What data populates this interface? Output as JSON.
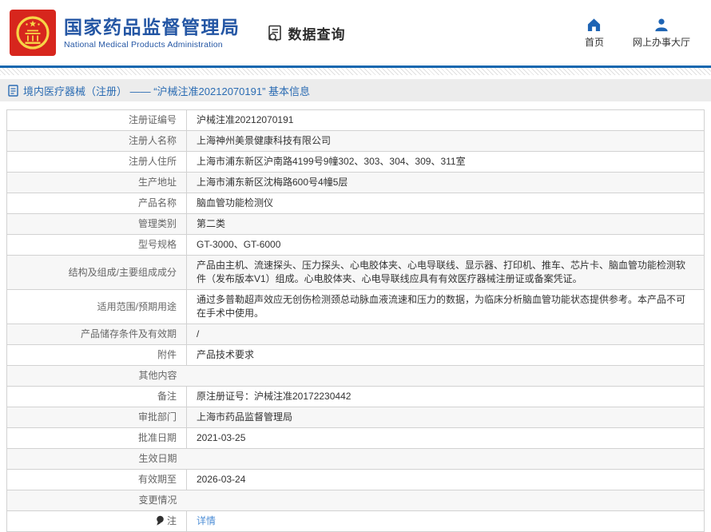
{
  "header": {
    "brand_cn": "国家药品监督管理局",
    "brand_en": "National Medical Products Administration",
    "section_title": "数据查询",
    "nav": [
      {
        "label": "首页",
        "icon": "home-icon"
      },
      {
        "label": "网上办事大厅",
        "icon": "user-icon"
      }
    ]
  },
  "breadcrumb": {
    "text": "境内医疗器械（注册） —— “沪械注准20212070191” 基本信息"
  },
  "table": {
    "rows": [
      {
        "label": "注册证编号",
        "value": "沪械注准20212070191"
      },
      {
        "label": "注册人名称",
        "value": "上海神州美景健康科技有限公司"
      },
      {
        "label": "注册人住所",
        "value": "上海市浦东新区沪南路4199号9幢302、303、304、309、311室"
      },
      {
        "label": "生产地址",
        "value": "上海市浦东新区沈梅路600号4幢5层"
      },
      {
        "label": "产品名称",
        "value": "脑血管功能检测仪"
      },
      {
        "label": "管理类别",
        "value": "第二类"
      },
      {
        "label": "型号规格",
        "value": "GT-3000、GT-6000"
      },
      {
        "label": "结构及组成/主要组成成分",
        "value": "产品由主机、流速探头、压力探头、心电胶体夹、心电导联线、显示器、打印机、推车、芯片卡、脑血管功能检测软件（发布版本V1）组成。心电胶体夹、心电导联线应具有有效医疗器械注册证或备案凭证。"
      },
      {
        "label": "适用范围/预期用途",
        "value": "通过多普勒超声效应无创伤检测颈总动脉血液流速和压力的数据，为临床分析脑血管功能状态提供参考。本产品不可在手术中使用。"
      },
      {
        "label": "产品储存条件及有效期",
        "value": "/"
      },
      {
        "label": "附件",
        "value": "产品技术要求"
      },
      {
        "label": "其他内容",
        "value": ""
      },
      {
        "label": "备注",
        "value": "原注册证号：沪械注准20172230442"
      },
      {
        "label": "审批部门",
        "value": "上海市药品监督管理局"
      },
      {
        "label": "批准日期",
        "value": "2021-03-25"
      },
      {
        "label": "生效日期",
        "value": ""
      },
      {
        "label": "有效期至",
        "value": "2026-03-24"
      },
      {
        "label": "变更情况",
        "value": ""
      },
      {
        "label": "注",
        "value": "详情",
        "link": true,
        "note_icon": true
      }
    ]
  },
  "colors": {
    "brand_blue": "#2456a4",
    "line_blue": "#1467af",
    "logo_red": "#d7261d",
    "emblem_gold": "#f7d547",
    "breadcrumb_blue": "#2b6cb3",
    "link_blue": "#4d8ed6",
    "bar_gray": "#ececec",
    "border_gray": "#d2d2d2",
    "alt_row": "#f7f7f7"
  }
}
